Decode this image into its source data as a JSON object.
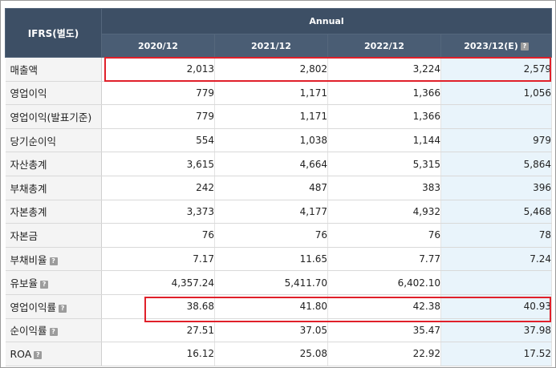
{
  "header": {
    "corner_label": "IFRS(별도)",
    "group_label": "Annual",
    "help_glyph": "?",
    "columns": [
      "2020/12",
      "2021/12",
      "2022/12",
      "2023/12(E)"
    ]
  },
  "rows": [
    {
      "label": "매출액",
      "values": [
        "2,013",
        "2,802",
        "3,224",
        "2,579"
      ]
    },
    {
      "label": "영업이익",
      "values": [
        "779",
        "1,171",
        "1,366",
        "1,056"
      ]
    },
    {
      "label": "영업이익(발표기준)",
      "values": [
        "779",
        "1,171",
        "1,366",
        ""
      ]
    },
    {
      "label": "당기순이익",
      "values": [
        "554",
        "1,038",
        "1,144",
        "979"
      ]
    },
    {
      "label": "자산총계",
      "values": [
        "3,615",
        "4,664",
        "5,315",
        "5,864"
      ]
    },
    {
      "label": "부채총계",
      "values": [
        "242",
        "487",
        "383",
        "396"
      ]
    },
    {
      "label": "자본총계",
      "values": [
        "3,373",
        "4,177",
        "4,932",
        "5,468"
      ]
    },
    {
      "label": "자본금",
      "values": [
        "76",
        "76",
        "76",
        "78"
      ]
    },
    {
      "label": "부채비율",
      "values": [
        "7.17",
        "11.65",
        "7.77",
        "7.24"
      ]
    },
    {
      "label": "유보율",
      "values": [
        "4,357.24",
        "5,411.70",
        "6,402.10",
        ""
      ]
    },
    {
      "label": "영업이익률",
      "values": [
        "38.68",
        "41.80",
        "42.38",
        "40.93"
      ]
    },
    {
      "label": "순이익률",
      "values": [
        "27.51",
        "37.05",
        "35.47",
        "37.98"
      ]
    },
    {
      "label": "ROA",
      "values": [
        "16.12",
        "25.08",
        "22.92",
        "17.52"
      ]
    }
  ],
  "colors": {
    "header_bg": "#3d4f65",
    "estimate_col_bg": "#e9f4fb",
    "highlight_border": "#e0202a"
  }
}
